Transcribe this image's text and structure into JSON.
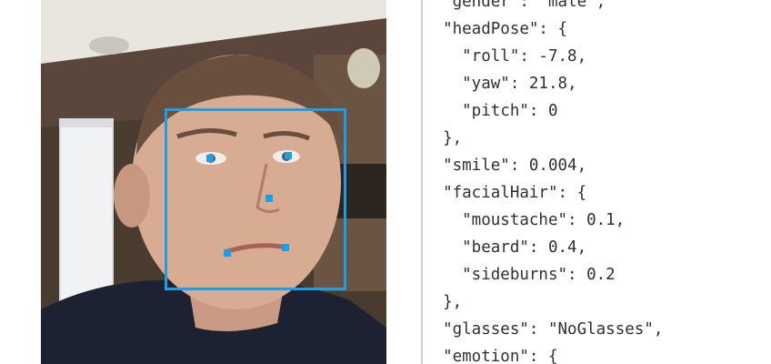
{
  "code_panel": {
    "lines": [
      "  \"gender\": \"male\",",
      "  \"headPose\": {",
      "    \"roll\": -7.8,",
      "    \"yaw\": 21.8,",
      "    \"pitch\": 0",
      "  },",
      "  \"smile\": 0.004,",
      "  \"facialHair\": {",
      "    \"moustache\": 0.1,",
      "    \"beard\": 0.4,",
      "    \"sideburns\": 0.2",
      "  },",
      "  \"glasses\": \"NoGlasses\",",
      "  \"emotion\": {"
    ]
  },
  "photo": {
    "subject": "face photo with detection overlay",
    "face_box": {
      "label": ""
    },
    "landmarks": [
      "left-pupil",
      "right-pupil",
      "nose-tip",
      "mouth-left",
      "mouth-right"
    ],
    "accent_color": "#1e9ee6"
  }
}
